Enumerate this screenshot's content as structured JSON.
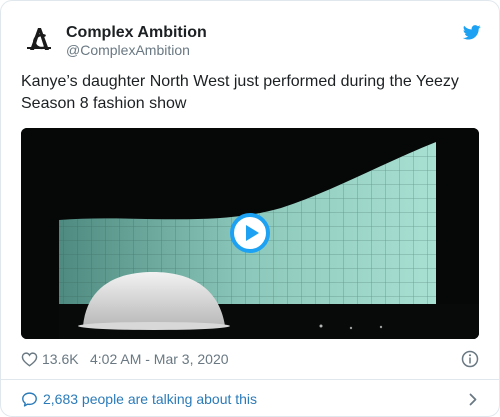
{
  "author": {
    "name": "Complex Ambition",
    "handle": "@ComplexAmbition",
    "avatar_icon": "complex-ambition-logo-icon"
  },
  "tweet": {
    "text": "Kanye’s daughter North West just performed during the Yeezy Season 8 fashion show"
  },
  "media": {
    "type": "video",
    "play_icon": "play-icon"
  },
  "meta": {
    "like_count": "13.6K",
    "timestamp": "4:02 AM - Mar 3, 2020",
    "like_icon": "heart-icon",
    "info_icon": "info-icon"
  },
  "conversation": {
    "text": "2,683 people are talking about this",
    "icon": "speech-bubble-icon",
    "chevron_icon": "chevron-right-icon"
  },
  "colors": {
    "brand_blue": "#1da1f2",
    "link_blue": "#2b7bb9",
    "secondary_text": "#697882",
    "border": "#e1e8ed"
  }
}
